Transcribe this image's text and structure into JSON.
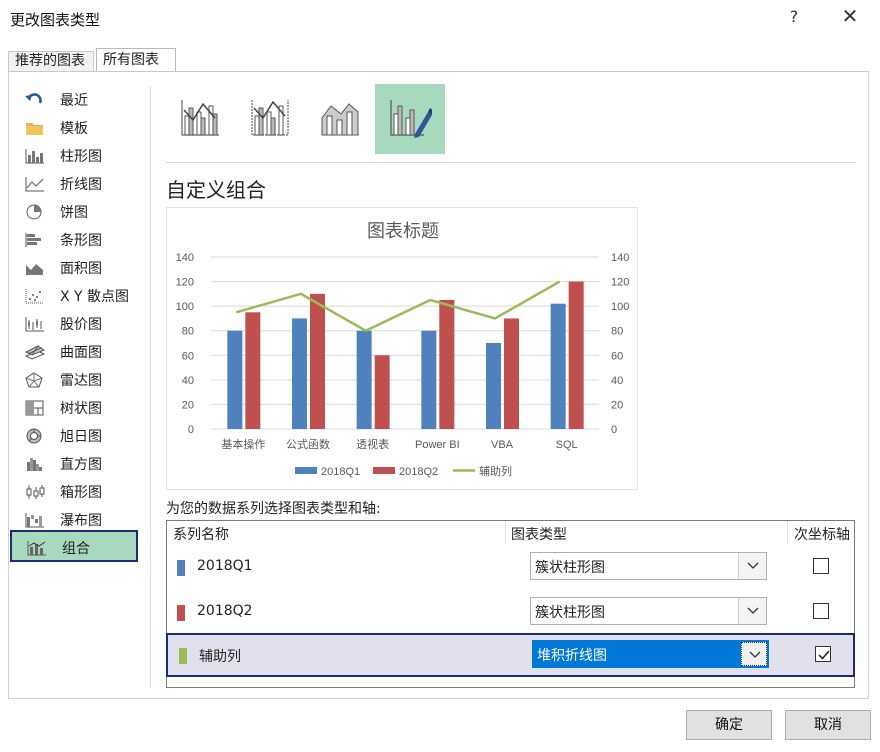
{
  "window": {
    "title": "更改图表类型",
    "help": "?",
    "close": "✕"
  },
  "tabs": [
    {
      "label": "推荐的图表"
    },
    {
      "label": "所有图表"
    }
  ],
  "sidebar": {
    "items": [
      {
        "label": "最近",
        "icon": "recent-icon"
      },
      {
        "label": "模板",
        "icon": "folder-icon"
      },
      {
        "label": "柱形图",
        "icon": "column-chart-icon"
      },
      {
        "label": "折线图",
        "icon": "line-chart-icon"
      },
      {
        "label": "饼图",
        "icon": "pie-chart-icon"
      },
      {
        "label": "条形图",
        "icon": "bar-chart-icon"
      },
      {
        "label": "面积图",
        "icon": "area-chart-icon"
      },
      {
        "label": "X Y 散点图",
        "icon": "scatter-chart-icon"
      },
      {
        "label": "股价图",
        "icon": "stock-chart-icon"
      },
      {
        "label": "曲面图",
        "icon": "surface-chart-icon"
      },
      {
        "label": "雷达图",
        "icon": "radar-chart-icon"
      },
      {
        "label": "树状图",
        "icon": "treemap-icon"
      },
      {
        "label": "旭日图",
        "icon": "sunburst-icon"
      },
      {
        "label": "直方图",
        "icon": "histogram-icon"
      },
      {
        "label": "箱形图",
        "icon": "boxplot-icon"
      },
      {
        "label": "瀑布图",
        "icon": "waterfall-icon"
      },
      {
        "label": "组合",
        "icon": "combo-chart-icon",
        "selected": true
      }
    ]
  },
  "combo_types": [
    {
      "icon": "combo-column-line-icon"
    },
    {
      "icon": "combo-column-line-secondary-icon"
    },
    {
      "icon": "combo-area-column-icon"
    },
    {
      "icon": "custom-combo-icon",
      "selected": true
    }
  ],
  "section_title": "自定义组合",
  "chart_data": {
    "type": "bar",
    "title": "图表标题",
    "categories": [
      "基本操作",
      "公式函数",
      "透视表",
      "Power BI",
      "VBA",
      "SQL"
    ],
    "series": [
      {
        "name": "2018Q1",
        "type": "bar",
        "color": "#4f81bd",
        "values": [
          80,
          90,
          80,
          80,
          70,
          102
        ]
      },
      {
        "name": "2018Q2",
        "type": "bar",
        "color": "#c0504d",
        "values": [
          95,
          110,
          60,
          105,
          90,
          120
        ]
      },
      {
        "name": "辅助列",
        "type": "line",
        "axis": "secondary",
        "color": "#9bbb59",
        "values": [
          95,
          110,
          80,
          105,
          90,
          120
        ]
      }
    ],
    "ylim": [
      0,
      140
    ],
    "y2lim": [
      0,
      140
    ],
    "yticks": [
      "0",
      "20",
      "40",
      "60",
      "80",
      "100",
      "120",
      "140"
    ],
    "legend": "bottom",
    "grid": true
  },
  "series_instruction": "为您的数据系列选择图表类型和轴:",
  "table": {
    "headers": {
      "name": "系列名称",
      "type": "图表类型",
      "secondary": "次坐标轴"
    },
    "rows": [
      {
        "name": "2018Q1",
        "color": "#4f81bd",
        "chart_type": "簇状柱形图",
        "secondary": false
      },
      {
        "name": "2018Q2",
        "color": "#c0504d",
        "chart_type": "簇状柱形图",
        "secondary": false
      },
      {
        "name": "辅助列",
        "color": "#9bbb59",
        "chart_type": "堆积折线图",
        "secondary": true,
        "selected": true
      }
    ]
  },
  "buttons": {
    "ok": "确定",
    "cancel": "取消"
  }
}
